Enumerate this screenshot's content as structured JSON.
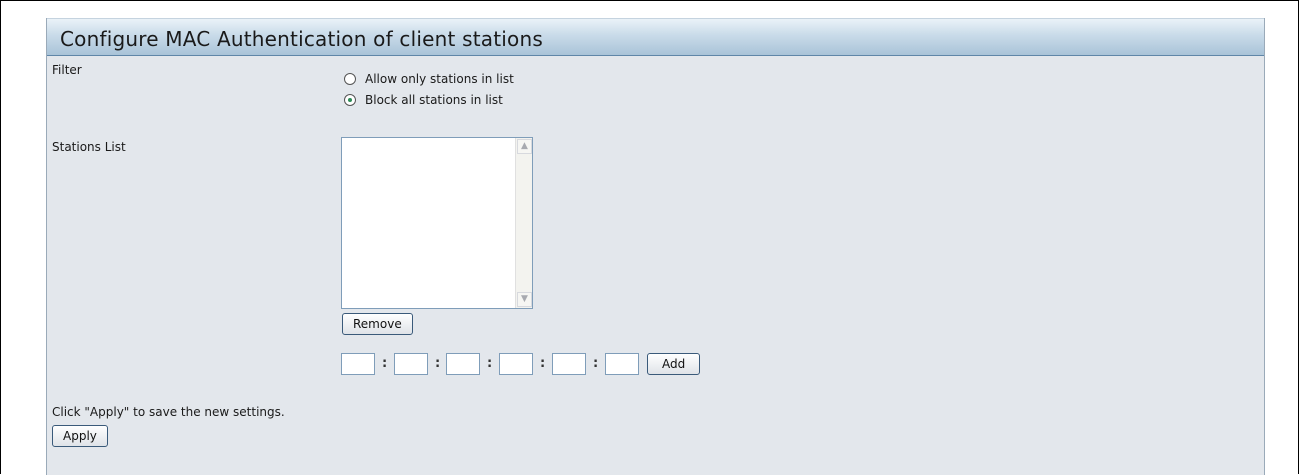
{
  "page": {
    "title": "Configure MAC Authentication of client stations"
  },
  "filter": {
    "label": "Filter",
    "options": [
      {
        "label": "Allow only stations in list",
        "checked": false
      },
      {
        "label": "Block all stations in list",
        "checked": true
      }
    ]
  },
  "stations": {
    "label": "Stations List",
    "items": [],
    "remove_label": "Remove",
    "mac_fields": [
      "",
      "",
      "",
      "",
      "",
      ""
    ],
    "separator": ":",
    "add_label": "Add"
  },
  "footer": {
    "hint": "Click \"Apply\" to save the new settings.",
    "apply_label": "Apply"
  },
  "colors": {
    "panel_bg": "#e3e7ec",
    "header_gradient_bottom": "#a9c3d8",
    "radio_checked": "#2e8b57"
  }
}
